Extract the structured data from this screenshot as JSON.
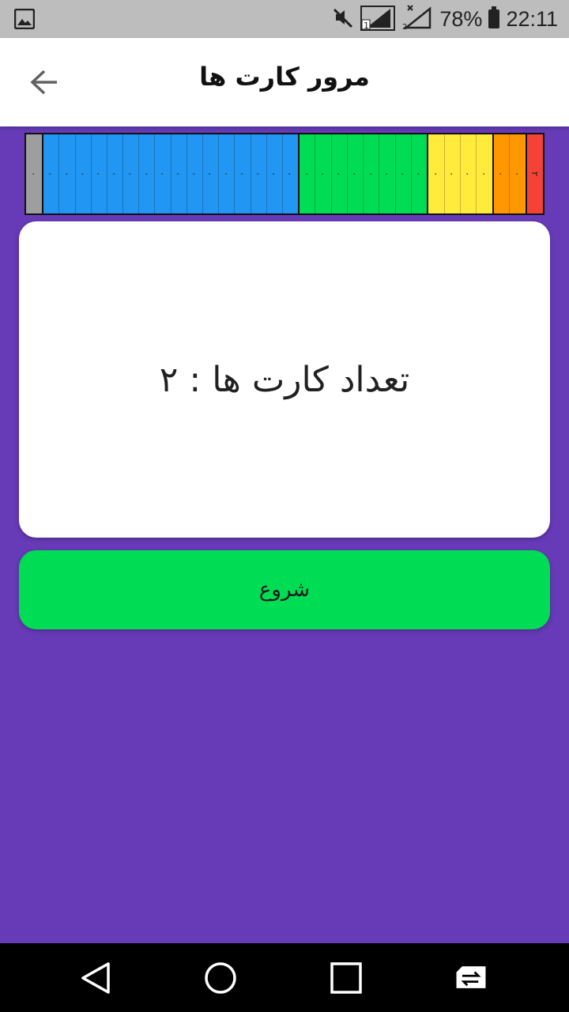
{
  "status_bar": {
    "battery": "78%",
    "time": "22:11",
    "sim1": "1",
    "sim2": "2"
  },
  "app_bar": {
    "title": "مرور کارت ها"
  },
  "leitner": {
    "boxes": [
      {
        "color": "#9E9E9E",
        "cells": [
          "٠"
        ]
      },
      {
        "color": "#2196F3",
        "cells": [
          "٠",
          "٠",
          "٠",
          "٠",
          "٠",
          "٠",
          "٠",
          "٠",
          "٠",
          "٠",
          "٠",
          "٠",
          "٠",
          "٠",
          "٠",
          "٠"
        ]
      },
      {
        "color": "#00DD55",
        "cells": [
          "٠",
          "٠",
          "٠",
          "٠",
          "٠",
          "٠",
          "٠",
          "٠"
        ]
      },
      {
        "color": "#FFEB3B",
        "cells": [
          "٠",
          "٠",
          "٠",
          "٠"
        ]
      },
      {
        "color": "#FF9800",
        "cells": [
          "٠",
          "٠"
        ]
      },
      {
        "color": "#F44336",
        "cells": [
          "٢"
        ]
      }
    ]
  },
  "card": {
    "text": "تعداد کارت ها : ۲"
  },
  "start_button": {
    "label": "شروع"
  },
  "colors": {
    "background": "#673AB7",
    "start": "#00DD55"
  }
}
